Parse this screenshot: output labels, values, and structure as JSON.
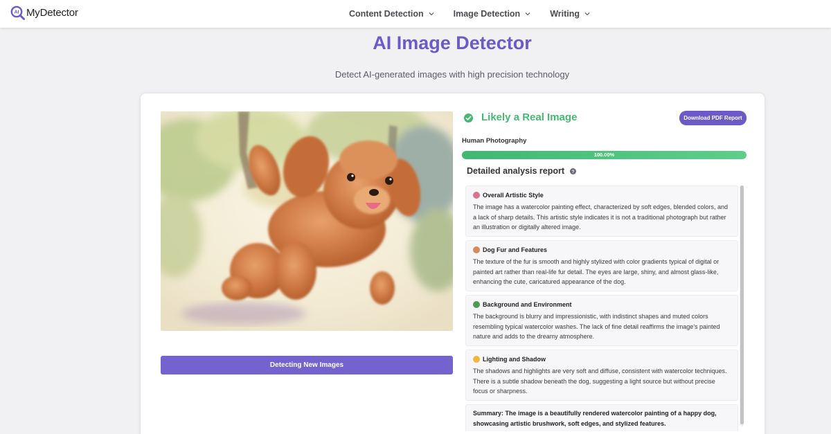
{
  "nav": {
    "logo_text": "MyDetector",
    "menu": [
      {
        "label": "Content Detection"
      },
      {
        "label": "Image Detection"
      },
      {
        "label": "Writing"
      }
    ]
  },
  "hero": {
    "title": "AI Image Detector",
    "subtitle": "Detect AI-generated images with high precision technology"
  },
  "image_panel": {
    "button_label": "Detecting New Images"
  },
  "result": {
    "verdict": "Likely a Real Image",
    "download_label": "Download PDF Report",
    "category_label": "Human Photography",
    "confidence_text": "100.00%",
    "confidence_fraction": 1.0,
    "report_heading": "Detailed analysis report"
  },
  "report": {
    "sections": [
      {
        "icon": "palette-icon",
        "title": "Overall Artistic Style",
        "body": "The image has a watercolor painting effect, characterized by soft edges, blended colors, and a lack of sharp details. This artistic style indicates it is not a traditional photograph but rather an illustration or digitally altered image."
      },
      {
        "icon": "dog-icon",
        "title": "Dog Fur and Features",
        "body": "The texture of the fur is smooth and highly stylized with color gradients typical of digital or painted art rather than real-life fur detail. The eyes are large, shiny, and almost glass-like, enhancing the cute, caricatured appearance of the dog."
      },
      {
        "icon": "tree-icon",
        "title": "Background and Environment",
        "body": "The background is blurry and impressionistic, with indistinct shapes and muted colors resembling typical watercolor washes. The lack of fine detail reaffirms the image's painted nature and adds to the dreamy atmosphere."
      },
      {
        "icon": "sun-icon",
        "title": "Lighting and Shadow",
        "body": "The shadows and highlights are very soft and diffuse, consistent with watercolor techniques. There is a subtle shadow beneath the dog, suggesting a light source but without precise focus or sharpness."
      }
    ],
    "summary": "Summary: The image is a beautifully rendered watercolor painting of a happy dog, showcasing artistic brushwork, soft edges, and stylized features."
  },
  "colors": {
    "accent": "#6e59c9",
    "success": "#45b872",
    "button": "#7462cf"
  }
}
